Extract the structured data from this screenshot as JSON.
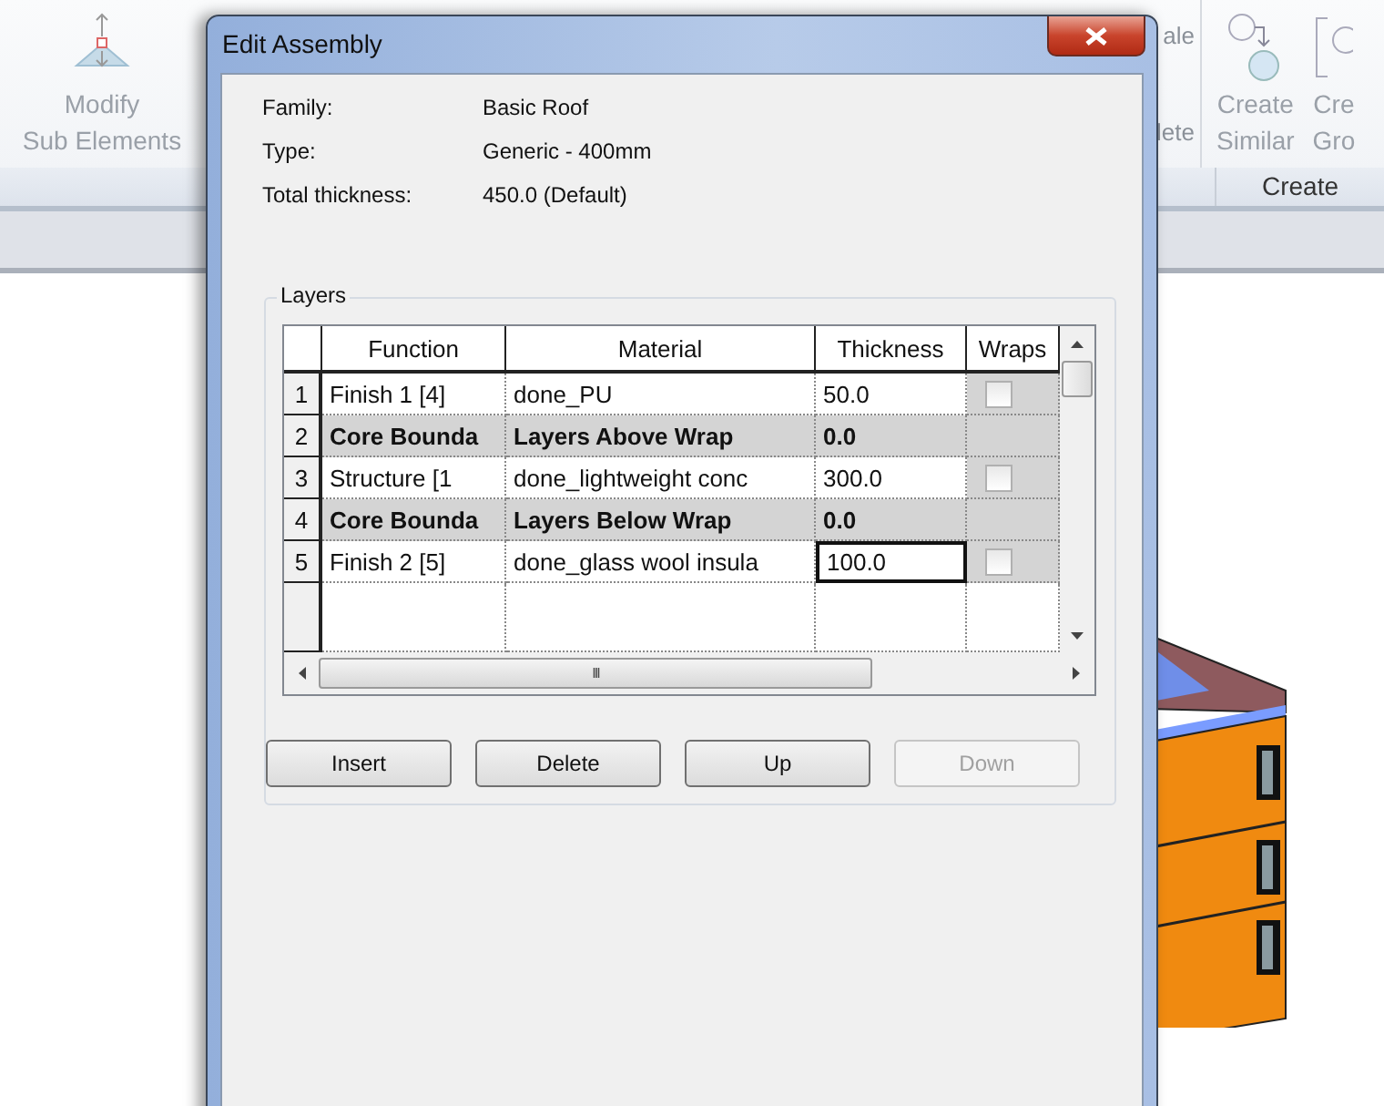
{
  "ribbon": {
    "modify_button": {
      "lines": [
        "Modify",
        "Sub Elements"
      ],
      "disabled": true
    },
    "hidden_group_lines": [
      "ale",
      "lete"
    ],
    "create_buttons": [
      {
        "lines": [
          "Create",
          "Similar"
        ],
        "disabled": true
      },
      {
        "lines": [
          "Cre",
          "Gro"
        ],
        "disabled": true
      }
    ],
    "create_panel_label": "Create"
  },
  "dialog": {
    "title": "Edit Assembly",
    "properties": [
      {
        "label": "Family:",
        "value": "Basic Roof"
      },
      {
        "label": "Type:",
        "value": "Generic - 400mm"
      },
      {
        "label": "Total thickness:",
        "value": "450.0 (Default)"
      }
    ],
    "group_title": "Layers",
    "table": {
      "columns": [
        "Function",
        "Material",
        "Thickness",
        "Wraps"
      ],
      "rows": [
        {
          "number": "1",
          "kind": "layer",
          "function": "Finish 1 [4]",
          "material": "done_PU",
          "thickness": "50.0",
          "wraps": false,
          "selected": false
        },
        {
          "number": "2",
          "kind": "boundary",
          "function": "Core Bounda",
          "material": "Layers Above Wrap",
          "thickness": "0.0",
          "selected": false
        },
        {
          "number": "3",
          "kind": "layer",
          "function": "Structure [1",
          "material": "done_lightweight conc",
          "thickness": "300.0",
          "wraps": false,
          "selected": false
        },
        {
          "number": "4",
          "kind": "boundary",
          "function": "Core Bounda",
          "material": "Layers Below Wrap",
          "thickness": "0.0",
          "selected": false
        },
        {
          "number": "5",
          "kind": "layer",
          "function": "Finish 2 [5]",
          "material": "done_glass wool insula",
          "thickness": "100.0",
          "wraps": false,
          "selected": true
        }
      ],
      "hscroll_grip": "III"
    },
    "buttons": [
      {
        "label": "Insert",
        "disabled": false
      },
      {
        "label": "Delete",
        "disabled": false
      },
      {
        "label": "Up",
        "disabled": false
      },
      {
        "label": "Down",
        "disabled": true
      }
    ]
  }
}
